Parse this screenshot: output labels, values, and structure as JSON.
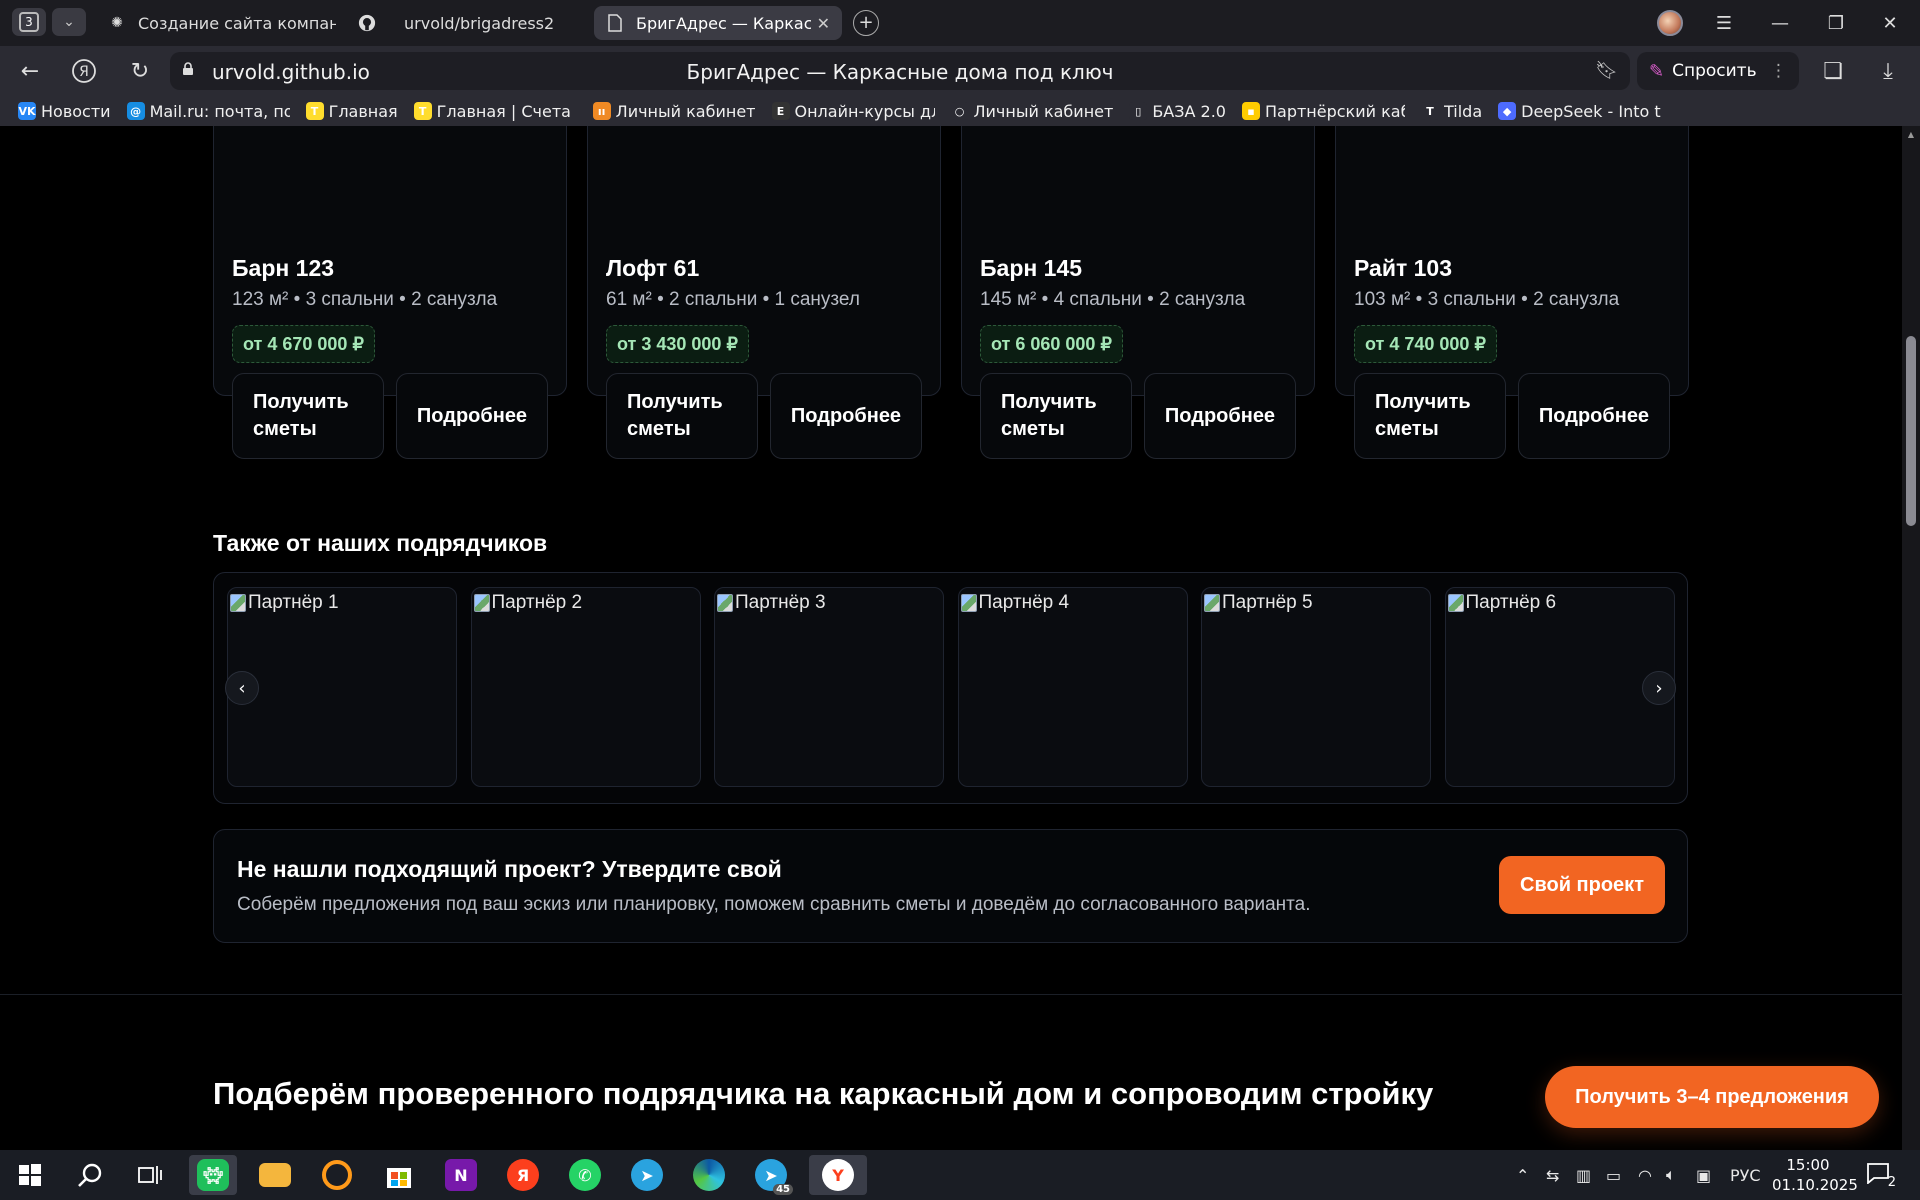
{
  "browser": {
    "tab_count": "3",
    "tabs": [
      {
        "title": "Создание сайта компании",
        "icon": "openai-icon"
      },
      {
        "title": "urvold/brigadress2",
        "icon": "github-icon"
      },
      {
        "title": "БригАдрес — Каркасные дома под ключ",
        "icon": "document-icon",
        "active": true
      }
    ],
    "url": "urvold.github.io",
    "page_title": "БригАдрес — Каркасные дома под ключ",
    "ask_label": "Спросить",
    "bookmarks": [
      {
        "label": "Новости",
        "color": "#2787f5",
        "glyph": "VK"
      },
      {
        "label": "Mail.ru: почта, поиск",
        "color": "#168de2",
        "glyph": "@"
      },
      {
        "label": "Главная",
        "color": "#ffdd2d",
        "glyph": "T"
      },
      {
        "label": "Главная | Счета и",
        "color": "#ffdd2d",
        "glyph": "T"
      },
      {
        "label": "Личный кабинет",
        "color": "#f08a24",
        "glyph": "ıı"
      },
      {
        "label": "Онлайн-курсы для",
        "color": "#333333",
        "glyph": "E"
      },
      {
        "label": "Личный кабинет",
        "color": "#2b2b33",
        "glyph": "○"
      },
      {
        "label": "БАЗА 2.0",
        "color": "#2b2b33",
        "glyph": "▯"
      },
      {
        "label": "Партнёрский кабинет",
        "color": "#ffcc00",
        "glyph": "▪"
      },
      {
        "label": "Tilda",
        "color": "#2b2b33",
        "glyph": "T"
      },
      {
        "label": "DeepSeek - Into the",
        "color": "#4d6bfe",
        "glyph": "◆"
      }
    ]
  },
  "projects": [
    {
      "name": "Барн 123",
      "meta": "123 м² • 3 спальни • 2 санузла",
      "price": "от 4 670 000 ₽"
    },
    {
      "name": "Лофт 61",
      "meta": "61 м² • 2 спальни • 1 санузел",
      "price": "от 3 430 000 ₽"
    },
    {
      "name": "Барн 145",
      "meta": "145 м² • 4 спальни • 2 санузла",
      "price": "от 6 060 000 ₽"
    },
    {
      "name": "Райт 103",
      "meta": "103 м² • 3 спальни • 2 санузла",
      "price": "от 4 740 000 ₽"
    }
  ],
  "card_buttons": {
    "estimate_line1": "Получить",
    "estimate_line2": "сметы",
    "details": "Подробнее"
  },
  "partners_section": {
    "title": "Также от наших подрядчиков",
    "partners": [
      "Партнёр 1",
      "Партнёр 2",
      "Партнёр 3",
      "Партнёр 4",
      "Партнёр 5",
      "Партнёр 6"
    ],
    "prev": "‹",
    "next": "›"
  },
  "cta": {
    "title": "Не нашли подходящий проект? Утвердите свой",
    "subtitle": "Соберём предложения под ваш эскиз или планировку, поможем сравнить сметы и доведём до согласованного варианта.",
    "button": "Свой проект"
  },
  "next_section": {
    "title": "Подберём проверенного подрядчика на каркасный дом и сопроводим стройку"
  },
  "floating_button": "Получить 3–4 предложения",
  "colors": {
    "accent": "#f26522",
    "price_text": "#a5e6b6",
    "price_bg": "#0b1d12",
    "page_bg": "#000000"
  },
  "taskbar": {
    "time": "15:00",
    "date": "01.10.2025",
    "language": "РУС",
    "notifications": "2",
    "telegram_badge": "45",
    "apps": [
      "start-icon",
      "search-icon",
      "task-view-icon",
      "sticker-app-icon",
      "file-explorer-icon",
      "yandex-music-icon",
      "store-icon",
      "onenote-icon",
      "yandex-icon",
      "whatsapp-icon",
      "telegram-icon",
      "edge-icon",
      "telegram-badge-icon",
      "yandex-browser-icon"
    ]
  }
}
